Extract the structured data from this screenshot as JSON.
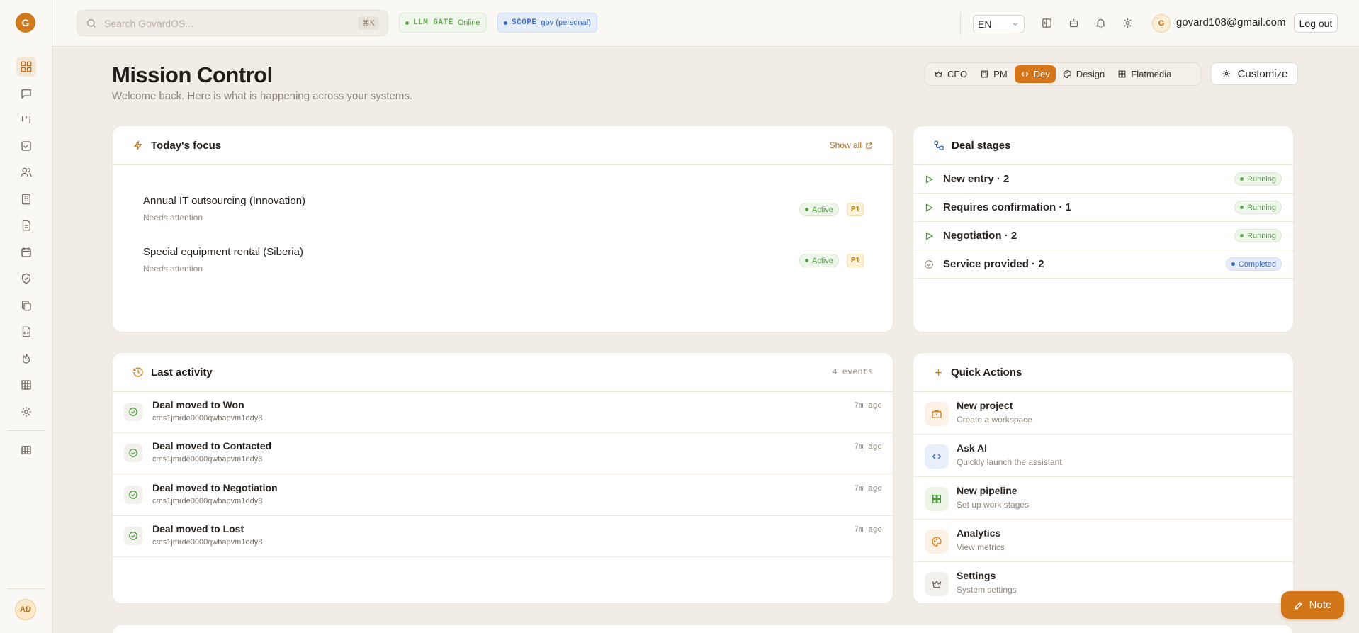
{
  "app": {
    "logo_letter": "G"
  },
  "topbar": {
    "search_placeholder": "Search GovardOS...",
    "search_shortcut": "⌘K",
    "llm_gate": {
      "key": "LLM GATE",
      "value": "Online"
    },
    "scope": {
      "key": "SCOPE",
      "value": "gov (personal)"
    },
    "language": "EN",
    "user_initial": "G",
    "user_email": "govard108@gmail.com",
    "logout_label": "Log out"
  },
  "sidebar": {
    "items": [
      "dashboard-icon",
      "chat-icon",
      "columns-icon",
      "tasks-icon",
      "users-icon",
      "building-icon",
      "document-icon",
      "calendar-icon",
      "shield-icon",
      "copy-icon",
      "code-file-icon",
      "flame-icon",
      "grid-icon",
      "settings-icon",
      "table-icon"
    ],
    "active_item": "dashboard-icon",
    "user_initials": "AD"
  },
  "header": {
    "title": "Mission Control",
    "subtitle": "Welcome back. Here is what is happening across your systems.",
    "roles": [
      "CEO",
      "PM",
      "Dev",
      "Design",
      "Flatmedia"
    ],
    "active_role": "Dev",
    "customize_label": "Customize"
  },
  "focus": {
    "title": "Today's focus",
    "show_all": "Show all",
    "items": [
      {
        "title": "Annual IT outsourcing (Innovation)",
        "subtitle": "Needs attention",
        "status": "Active",
        "priority": "P1"
      },
      {
        "title": "Special equipment rental (Siberia)",
        "subtitle": "Needs attention",
        "status": "Active",
        "priority": "P1"
      }
    ]
  },
  "stages": {
    "title": "Deal stages",
    "items": [
      {
        "label": "New entry · 2",
        "status": "Running"
      },
      {
        "label": "Requires confirmation · 1",
        "status": "Running"
      },
      {
        "label": "Negotiation · 2",
        "status": "Running"
      },
      {
        "label": "Service provided · 2",
        "status": "Completed"
      }
    ]
  },
  "activity": {
    "title": "Last activity",
    "count": "4 events",
    "items": [
      {
        "title": "Deal moved to Won",
        "id": "cms1jmrde0000qwbapvm1ddy8",
        "time": "7m ago"
      },
      {
        "title": "Deal moved to Contacted",
        "id": "cms1jmrde0000qwbapvm1ddy8",
        "time": "7m ago"
      },
      {
        "title": "Deal moved to Negotiation",
        "id": "cms1jmrde0000qwbapvm1ddy8",
        "time": "7m ago"
      },
      {
        "title": "Deal moved to Lost",
        "id": "cms1jmrde0000qwbapvm1ddy8",
        "time": "7m ago"
      }
    ]
  },
  "quick_actions": {
    "title": "Quick Actions",
    "items": [
      {
        "title": "New project",
        "subtitle": "Create a workspace",
        "icon": "briefcase-icon"
      },
      {
        "title": "Ask AI",
        "subtitle": "Quickly launch the assistant",
        "icon": "code-icon"
      },
      {
        "title": "New pipeline",
        "subtitle": "Set up work stages",
        "icon": "grid-icon"
      },
      {
        "title": "Analytics",
        "subtitle": "View metrics",
        "icon": "palette-icon"
      },
      {
        "title": "Settings",
        "subtitle": "System settings",
        "icon": "crown-icon"
      }
    ]
  },
  "note_button": "Note",
  "colors": {
    "accent": "#d6741a",
    "success": "#5aa84a",
    "info": "#3c6bc5"
  }
}
